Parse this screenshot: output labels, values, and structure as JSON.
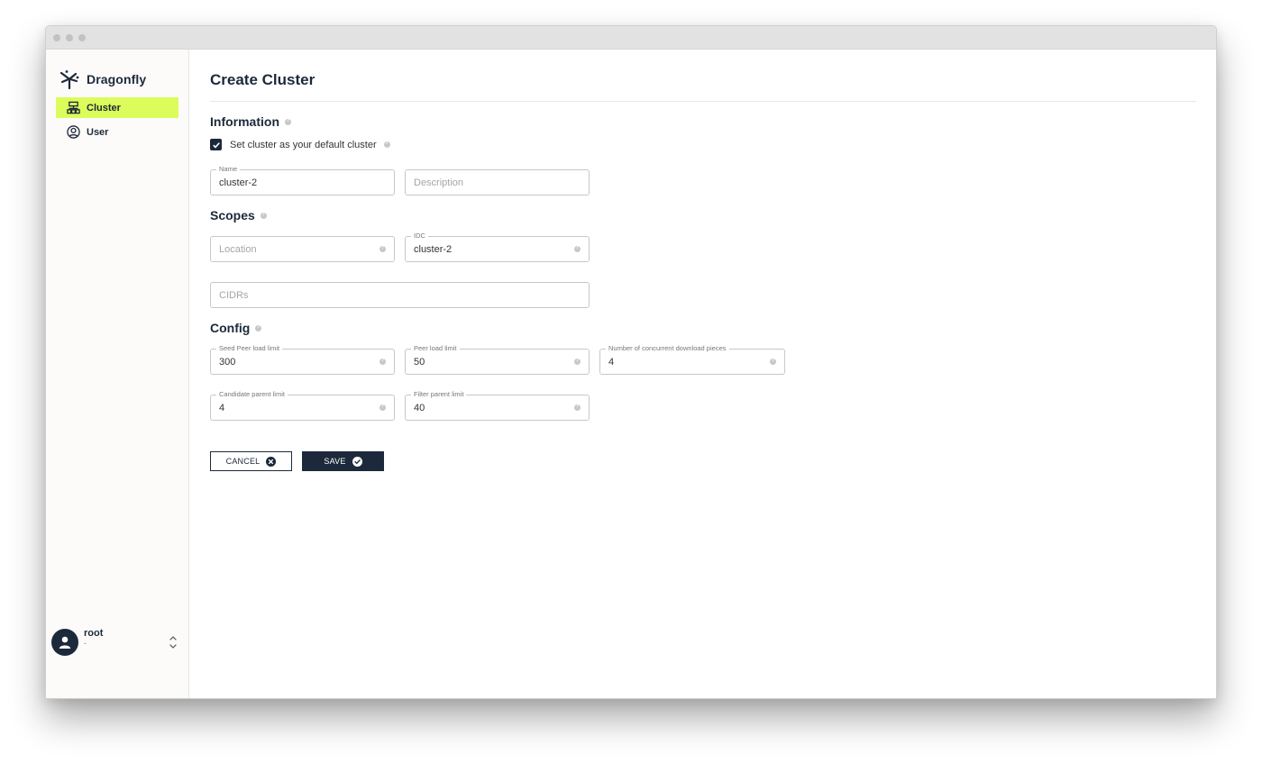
{
  "window": {
    "controls": [
      "close",
      "minimize",
      "maximize"
    ]
  },
  "sidebar": {
    "brand": {
      "name": "Dragonfly",
      "icon": "dragonfly-logo-icon"
    },
    "items": [
      {
        "label": "Cluster",
        "icon": "cluster-hierarchy-icon",
        "active": true
      },
      {
        "label": "User",
        "icon": "user-circle-icon",
        "active": false
      }
    ],
    "user": {
      "name": "root",
      "subtitle": "-",
      "toggle_icon": "chevron-up-down-icon"
    }
  },
  "colors": {
    "accent": "#dcfc5b",
    "primary": "#1c293a"
  },
  "page": {
    "title": "Create Cluster",
    "information": {
      "title": "Information",
      "default_checkbox": {
        "label": "Set cluster as your default cluster",
        "checked": true
      },
      "name": {
        "label": "Name",
        "value": "cluster-2"
      },
      "description": {
        "placeholder": "Description",
        "value": ""
      }
    },
    "scopes": {
      "title": "Scopes",
      "location": {
        "placeholder": "Location",
        "value": ""
      },
      "idc": {
        "label": "IDC",
        "value": "cluster-2"
      },
      "cidrs": {
        "placeholder": "CIDRs",
        "value": ""
      }
    },
    "config": {
      "title": "Config",
      "seed_peer_load_limit": {
        "label": "Seed Peer load limit",
        "value": "300"
      },
      "peer_load_limit": {
        "label": "Peer load limit",
        "value": "50"
      },
      "concurrent_download_pieces": {
        "label": "Number of concurrent download pieces",
        "value": "4"
      },
      "candidate_parent_limit": {
        "label": "Candidate parent limit",
        "value": "4"
      },
      "filter_parent_limit": {
        "label": "Filter parent limit",
        "value": "40"
      }
    },
    "actions": {
      "cancel_label": "CANCEL",
      "save_label": "SAVE"
    }
  }
}
